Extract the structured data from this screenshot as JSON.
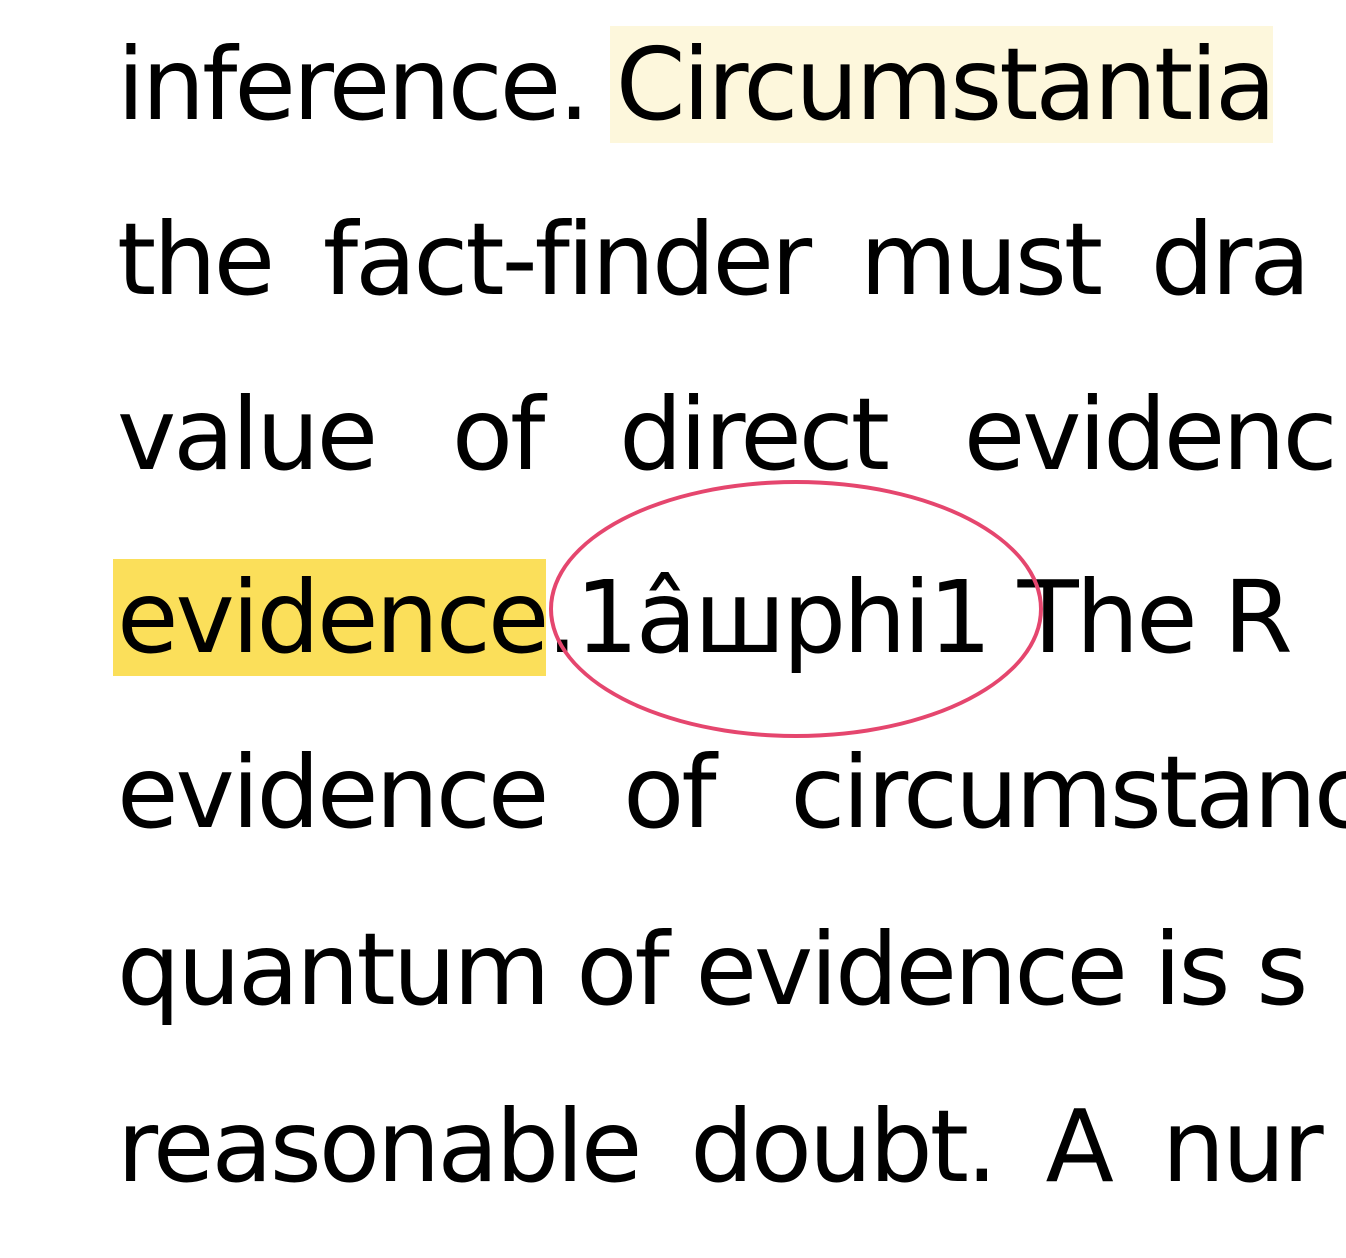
{
  "document": {
    "lines": [
      {
        "id": "l1",
        "parts": [
          "inference. ",
          "Circumstantia"
        ]
      },
      {
        "id": "l2",
        "parts": [
          "the fact-finder must dra"
        ]
      },
      {
        "id": "l3",
        "parts": [
          "value of direct evidenc"
        ]
      },
      {
        "id": "l4",
        "parts": [
          "evidence",
          ".1âшphi1 The R"
        ]
      },
      {
        "id": "l5",
        "parts": [
          "evidence of circumstanc"
        ]
      },
      {
        "id": "l6",
        "parts": [
          "quantum of evidence is s"
        ]
      },
      {
        "id": "l7",
        "parts": [
          "reasonable doubt. A nur"
        ]
      }
    ]
  },
  "annotations": {
    "highlight_light_color": "#fdf7dc",
    "highlight_strong_color": "#fbdf5a",
    "ellipse_color": "#e5466e"
  }
}
